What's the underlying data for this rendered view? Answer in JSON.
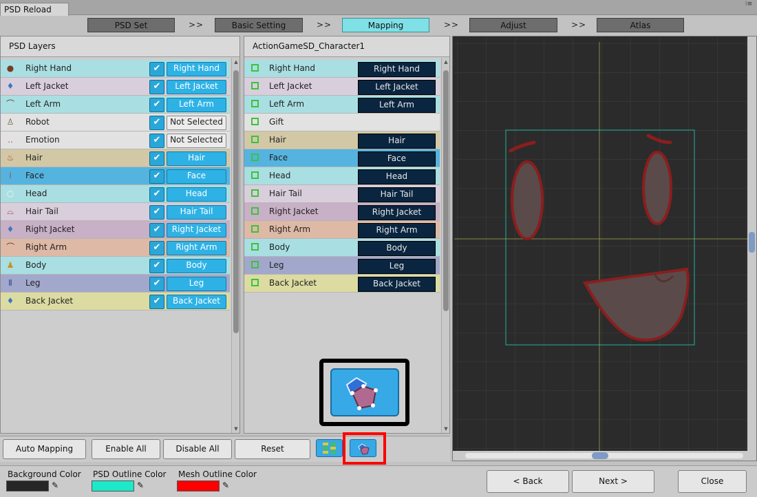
{
  "window": {
    "title": "PSD Reload",
    "menu_glyph": "⁝≡"
  },
  "steps": {
    "items": [
      {
        "label": "PSD Set"
      },
      {
        "label": "Basic Setting"
      },
      {
        "label": "Mapping"
      },
      {
        "label": "Adjust"
      },
      {
        "label": "Atlas"
      }
    ],
    "separator": ">>",
    "active_index": 2
  },
  "psd_layers": {
    "header": "PSD Layers",
    "rows": [
      {
        "name": "Right Hand",
        "mapped": "Right Hand",
        "checked": true,
        "icon": "hand-icon",
        "bg": "#a9dfe2"
      },
      {
        "name": "Left Jacket",
        "mapped": "Left Jacket",
        "checked": true,
        "icon": "jacket-icon",
        "bg": "#d9cfdc"
      },
      {
        "name": "Left Arm",
        "mapped": "Left Arm",
        "checked": true,
        "icon": "arm-icon",
        "bg": "#a9dfe2"
      },
      {
        "name": "Robot",
        "mapped": "Not Selected",
        "checked": true,
        "icon": "robot-icon",
        "bg": "#e2e2e2"
      },
      {
        "name": "Emotion",
        "mapped": "Not Selected",
        "checked": true,
        "icon": "emotion-icon",
        "bg": "#e2e2e2"
      },
      {
        "name": "Hair",
        "mapped": "Hair",
        "checked": true,
        "icon": "hair-icon",
        "bg": "#d3c8a6"
      },
      {
        "name": "Face",
        "mapped": "Face",
        "checked": true,
        "icon": "face-icon",
        "bg": "#55b3df"
      },
      {
        "name": "Head",
        "mapped": "Head",
        "checked": true,
        "icon": "head-icon",
        "bg": "#a9dfe2"
      },
      {
        "name": "Hair Tail",
        "mapped": "Hair Tail",
        "checked": true,
        "icon": "hair-tail-icon",
        "bg": "#d9cfdc"
      },
      {
        "name": "Right Jacket",
        "mapped": "Right Jacket",
        "checked": true,
        "icon": "jacket-icon",
        "bg": "#c8b0c6"
      },
      {
        "name": "Right Arm",
        "mapped": "Right Arm",
        "checked": true,
        "icon": "arm-icon",
        "bg": "#deb9a5"
      },
      {
        "name": "Body",
        "mapped": "Body",
        "checked": true,
        "icon": "body-icon",
        "bg": "#a9dfe2"
      },
      {
        "name": "Leg",
        "mapped": "Leg",
        "checked": true,
        "icon": "leg-icon",
        "bg": "#a2a8cb"
      },
      {
        "name": "Back Jacket",
        "mapped": "Back Jacket",
        "checked": true,
        "icon": "jacket-icon",
        "bg": "#dcdca2"
      }
    ]
  },
  "targets": {
    "header": "ActionGameSD_Character1",
    "rows": [
      {
        "name": "Right Hand",
        "mapped": "Right Hand",
        "bg": "#a9dfe2"
      },
      {
        "name": "Left Jacket",
        "mapped": "Left Jacket",
        "bg": "#d9cfdc"
      },
      {
        "name": "Left Arm",
        "mapped": "Left Arm",
        "bg": "#a9dfe2"
      },
      {
        "name": "Gift",
        "mapped": "",
        "bg": "#e2e2e2"
      },
      {
        "name": "Hair",
        "mapped": "Hair",
        "bg": "#d3c8a6"
      },
      {
        "name": "Face",
        "mapped": "Face",
        "bg": "#55b3df"
      },
      {
        "name": "Head",
        "mapped": "Head",
        "bg": "#a9dfe2"
      },
      {
        "name": "Hair Tail",
        "mapped": "Hair Tail",
        "bg": "#d9cfdc"
      },
      {
        "name": "Right Jacket",
        "mapped": "Right Jacket",
        "bg": "#c8b0c6"
      },
      {
        "name": "Right Arm",
        "mapped": "Right Arm",
        "bg": "#deb9a5"
      },
      {
        "name": "Body",
        "mapped": "Body",
        "bg": "#a9dfe2"
      },
      {
        "name": "Leg",
        "mapped": "Leg",
        "bg": "#a2a8cb"
      },
      {
        "name": "Back Jacket",
        "mapped": "Back Jacket",
        "bg": "#dcdca2"
      }
    ]
  },
  "actions": {
    "auto_mapping": "Auto Mapping",
    "enable_all": "Enable All",
    "disable_all": "Disable All",
    "reset": "Reset"
  },
  "view_mode": {
    "grid_icon": "grid-view-icon",
    "mesh_icon": "mesh-view-icon",
    "selected": "mesh"
  },
  "footer": {
    "background_color_label": "Background Color",
    "psd_outline_label": "PSD Outline Color",
    "mesh_outline_label": "Mesh Outline Color",
    "background_color": "#262626",
    "psd_outline_color": "#1de9c9",
    "mesh_outline_color": "#ff0000",
    "back": "< Back",
    "next": "Next >",
    "close": "Close"
  },
  "colors": {
    "highlight_red": "#ff0000",
    "callout_black": "#000000",
    "step_active": "#7fe0e6",
    "check_blue": "#2aa7d8"
  }
}
